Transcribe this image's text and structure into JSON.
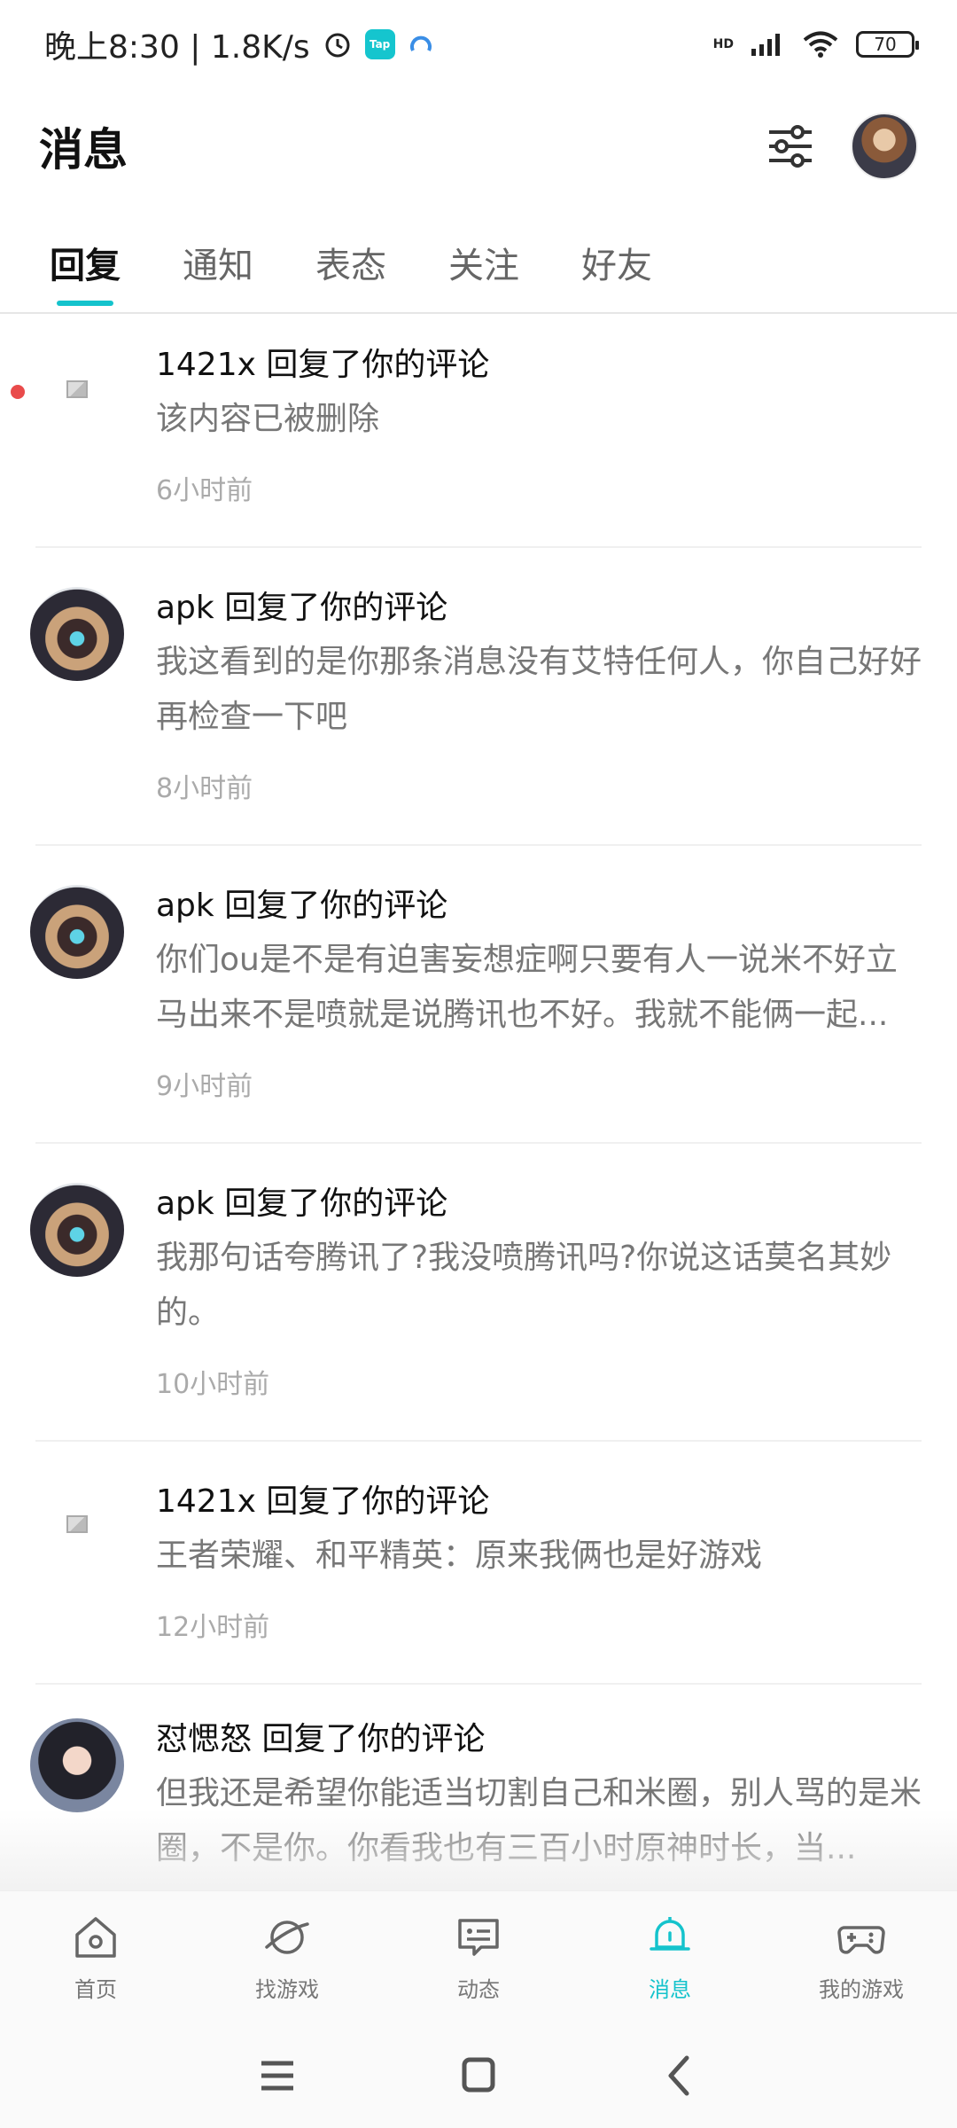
{
  "status_bar": {
    "time_speed": "晚上8:30 | 1.8K/s",
    "tap_label": "Tap",
    "network_label": "HD",
    "battery": "70"
  },
  "header": {
    "title": "消息"
  },
  "tabs": [
    {
      "label": "回复",
      "active": true
    },
    {
      "label": "通知",
      "active": false
    },
    {
      "label": "表态",
      "active": false
    },
    {
      "label": "关注",
      "active": false
    },
    {
      "label": "好友",
      "active": false
    }
  ],
  "messages": [
    {
      "user": "1421x",
      "action": "回复了你的评论",
      "title": "1421x 回复了你的评论",
      "content": "该内容已被删除",
      "time": "6小时前",
      "unread": true,
      "avatar": "placeholder"
    },
    {
      "user": "apk",
      "action": "回复了你的评论",
      "title": "apk 回复了你的评论",
      "content": "我这看到的是你那条消息没有艾特任何人，你自己好好再检查一下吧",
      "time": "8小时前",
      "unread": false,
      "avatar": "char1"
    },
    {
      "user": "apk",
      "action": "回复了你的评论",
      "title": "apk 回复了你的评论",
      "content": "你们ou是不是有迫害妄想症啊只要有人一说米不好立马出来不是喷就是说腾讯也不好。我就不能俩一起...",
      "time": "9小时前",
      "unread": false,
      "avatar": "char1"
    },
    {
      "user": "apk",
      "action": "回复了你的评论",
      "title": "apk 回复了你的评论",
      "content": "我那句话夸腾讯了?我没喷腾讯吗?你说这话莫名其妙的。",
      "time": "10小时前",
      "unread": false,
      "avatar": "char1"
    },
    {
      "user": "1421x",
      "action": "回复了你的评论",
      "title": "1421x 回复了你的评论",
      "content": "王者荣耀、和平精英：原来我俩也是好游戏",
      "time": "12小时前",
      "unread": false,
      "avatar": "placeholder"
    },
    {
      "user": "怼愢怒",
      "action": "回复了你的评论",
      "title": "怼愢怒 回复了你的评论",
      "content": "但我还是希望你能适当切割自己和米圈，别人骂的是米圈，不是你。你看我也有三百小时原神时长，当...",
      "time": "",
      "unread": false,
      "avatar": "char2"
    }
  ],
  "bottom_nav": [
    {
      "label": "首页",
      "icon": "home-icon",
      "active": false
    },
    {
      "label": "找游戏",
      "icon": "planet-icon",
      "active": false
    },
    {
      "label": "动态",
      "icon": "chat-card-icon",
      "active": false
    },
    {
      "label": "消息",
      "icon": "bell-icon",
      "active": true
    },
    {
      "label": "我的游戏",
      "icon": "gamepad-icon",
      "active": false
    }
  ],
  "colors": {
    "accent": "#14c3cc",
    "unread_dot": "#e94b4b"
  }
}
